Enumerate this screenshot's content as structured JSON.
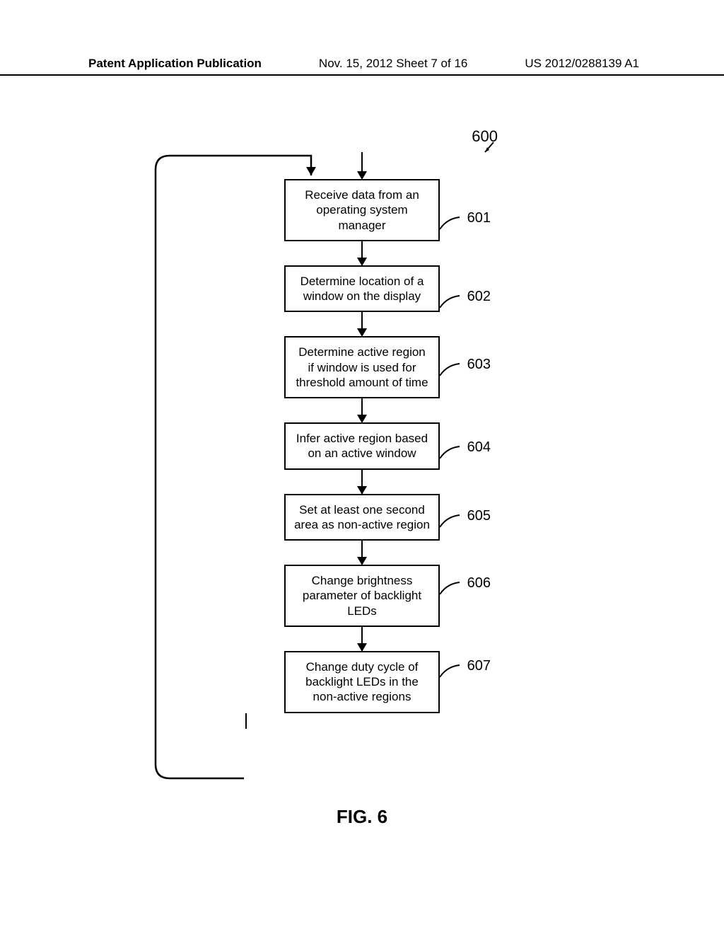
{
  "header": {
    "left": "Patent Application Publication",
    "center": "Nov. 15, 2012  Sheet 7 of 16",
    "right": "US 2012/0288139 A1"
  },
  "diagram": {
    "overall_ref": "600",
    "steps": [
      {
        "ref": "601",
        "text": "Receive data from an operating system manager"
      },
      {
        "ref": "602",
        "text": "Determine location of a window on the display"
      },
      {
        "ref": "603",
        "text": "Determine active region if window is used for threshold amount of time"
      },
      {
        "ref": "604",
        "text": "Infer active region based on an active window"
      },
      {
        "ref": "605",
        "text": "Set at least one second area as non-active region"
      },
      {
        "ref": "606",
        "text": "Change brightness parameter of backlight LEDs"
      },
      {
        "ref": "607",
        "text": "Change duty cycle of backlight LEDs in the non-active regions"
      }
    ]
  },
  "caption": "FIG. 6"
}
